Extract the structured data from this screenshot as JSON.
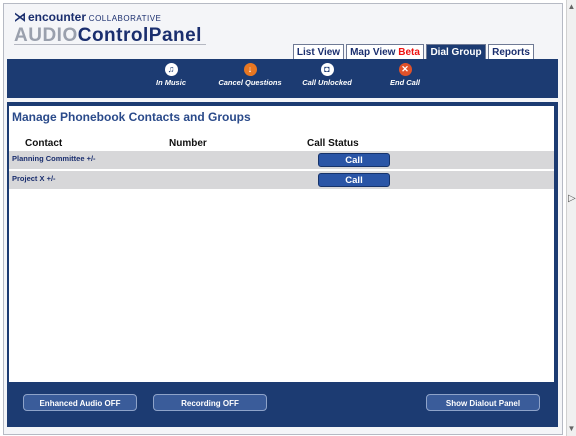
{
  "logo": {
    "brand": "encounter",
    "tagline": "COLLABORATIVE",
    "product_audio": "AUDIO",
    "product_cp": "ControlPanel"
  },
  "tabs": [
    {
      "label": "List View",
      "active": false
    },
    {
      "label": "Map View",
      "suffix": "Beta",
      "active": false
    },
    {
      "label": "Dial Group",
      "active": true
    },
    {
      "label": "Reports",
      "active": false
    }
  ],
  "toolbar": {
    "items": [
      {
        "label": "In Music",
        "icon": "music-icon"
      },
      {
        "label": "Cancel Questions",
        "icon": "down-arrow-icon"
      },
      {
        "label": "Call Unlocked",
        "icon": "lock-icon"
      },
      {
        "label": "End Call",
        "icon": "close-icon"
      }
    ]
  },
  "panel": {
    "title": "Manage Phonebook Contacts and Groups",
    "columns": [
      "Contact",
      "Number",
      "Call Status"
    ],
    "rows": [
      {
        "contact": "Planning Committee +/-",
        "number": "",
        "action": "Call"
      },
      {
        "contact": "Project X +/-",
        "number": "",
        "action": "Call"
      }
    ]
  },
  "bottom": {
    "enhanced_audio": "Enhanced Audio OFF",
    "recording": "Recording OFF",
    "dialout": "Show Dialout Panel"
  },
  "colors": {
    "navy": "#1c3b72",
    "accent_orange": "#e87722",
    "beta_red": "#e11111"
  }
}
